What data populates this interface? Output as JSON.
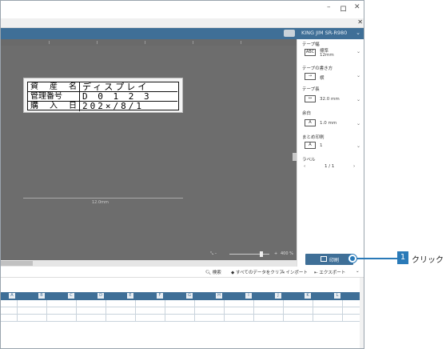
{
  "window": {
    "minimize": "–",
    "maximize": "ロ",
    "close": "✕",
    "sub_close": "✕"
  },
  "printer": {
    "name": "KING JIM SR-R980",
    "chevron": "⌄"
  },
  "label": {
    "rows": [
      {
        "key": [
          "資",
          "産",
          "名"
        ],
        "value": "ディスプレイ"
      },
      {
        "key": [
          "管理番号"
        ],
        "value": "D 0 1 2 3"
      },
      {
        "key": [
          "購",
          "入",
          "日"
        ],
        "value": "202×/8/1"
      }
    ]
  },
  "dimension": "12.0mm",
  "zoom": {
    "level": "400 %"
  },
  "panel": {
    "tape_width_label": "テープ幅",
    "tape_width_type": "標準",
    "tape_width_value": "12mm",
    "tape_direction_label": "テープの書き方",
    "tape_direction_value": "横",
    "tape_length_label": "テープ長",
    "tape_length_value": "32.0 mm",
    "margin_label": "余白",
    "margin_value": "1.0 mm",
    "cut_label": "まとめ印刷",
    "cut_value": "1",
    "label_label": "ラベル",
    "page_indicator": "1 / 1"
  },
  "print_button": {
    "label": "印刷"
  },
  "callout": {
    "number": "1",
    "text": "クリック"
  },
  "toolbar2": {
    "search": "検索",
    "clear_all": "すべてのデータをクリア",
    "import": "インポート",
    "export": "エクスポート"
  },
  "grid": {
    "columns": [
      "A",
      "B",
      "C",
      "D",
      "E",
      "F",
      "G",
      "H",
      "I",
      "J",
      "K",
      "L"
    ]
  }
}
